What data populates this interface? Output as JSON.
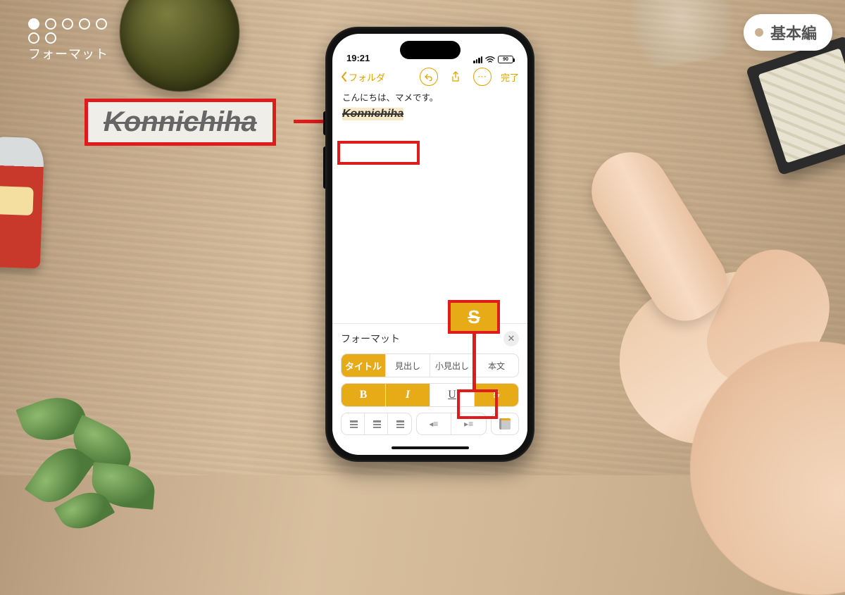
{
  "overlay": {
    "progress_label": "フォーマット",
    "pill_label": "基本編"
  },
  "callout": {
    "word": "Konnichiha",
    "s_label": "S"
  },
  "status": {
    "time": "19:21",
    "battery": "90"
  },
  "topbar": {
    "back_label": "フォルダ",
    "done_label": "完了"
  },
  "note": {
    "line1": "こんにちは、マメです。",
    "word": "Konnichiha"
  },
  "panel": {
    "title": "フォーマット",
    "styles": {
      "title": "タイトル",
      "heading": "見出し",
      "subheading": "小見出し",
      "body": "本文"
    },
    "bius": {
      "b": "B",
      "i": "I",
      "u": "U",
      "s": "S"
    }
  }
}
